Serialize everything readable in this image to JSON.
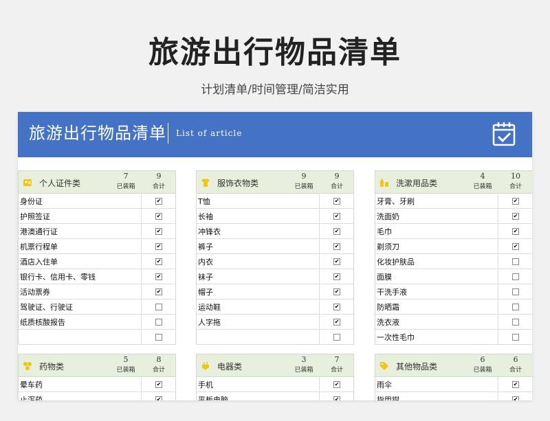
{
  "header": {
    "title": "旅游出行物品清单",
    "subtitle": "计划清单/时间管理/简洁实用"
  },
  "banner": {
    "title": "旅游出行物品清单",
    "subtitle": "List of article"
  },
  "labels": {
    "packed": "已装箱",
    "total": "合计"
  },
  "colors": {
    "banner": "#4472c4",
    "category_header": "#e6f0dc",
    "icon": "#f0c419"
  },
  "categories": [
    {
      "name": "个人证件类",
      "icon": "id-card-icon",
      "packed": "7",
      "total": "9",
      "items": [
        {
          "label": "身份证",
          "checked": true
        },
        {
          "label": "护照签证",
          "checked": true
        },
        {
          "label": "港澳通行证",
          "checked": true
        },
        {
          "label": "机票行程单",
          "checked": true
        },
        {
          "label": "酒店入住单",
          "checked": true
        },
        {
          "label": "银行卡、信用卡、零钱",
          "checked": true
        },
        {
          "label": "活动票券",
          "checked": true
        },
        {
          "label": "驾驶证、行驶证",
          "checked": false
        },
        {
          "label": "纸质核酸报告",
          "checked": false
        },
        {
          "label": "",
          "checked": false
        }
      ]
    },
    {
      "name": "服饰衣物类",
      "icon": "tshirt-icon",
      "packed": "9",
      "total": "9",
      "items": [
        {
          "label": "T恤",
          "checked": true
        },
        {
          "label": "长袖",
          "checked": true
        },
        {
          "label": "冲锋衣",
          "checked": true
        },
        {
          "label": "裤子",
          "checked": true
        },
        {
          "label": "内衣",
          "checked": true
        },
        {
          "label": "袜子",
          "checked": true
        },
        {
          "label": "帽子",
          "checked": true
        },
        {
          "label": "运动鞋",
          "checked": true
        },
        {
          "label": "人字拖",
          "checked": true
        },
        {
          "label": "",
          "checked": false
        }
      ]
    },
    {
      "name": "洗漱用品类",
      "icon": "toiletries-icon",
      "packed": "4",
      "total": "10",
      "items": [
        {
          "label": "牙膏、牙刷",
          "checked": true
        },
        {
          "label": "洗面奶",
          "checked": true
        },
        {
          "label": "毛巾",
          "checked": true
        },
        {
          "label": "剃须刀",
          "checked": true
        },
        {
          "label": "化妆护肤品",
          "checked": false
        },
        {
          "label": "面膜",
          "checked": false
        },
        {
          "label": "干洗手液",
          "checked": false
        },
        {
          "label": "防晒霜",
          "checked": false
        },
        {
          "label": "洗衣液",
          "checked": false
        },
        {
          "label": "一次性毛巾",
          "checked": false
        }
      ]
    },
    {
      "name": "药物类",
      "icon": "medicine-icon",
      "packed": "5",
      "total": "8",
      "items": [
        {
          "label": "晕车药",
          "checked": true
        },
        {
          "label": "止泻药",
          "checked": true
        }
      ]
    },
    {
      "name": "电器类",
      "icon": "plug-icon",
      "packed": "3",
      "total": "7",
      "items": [
        {
          "label": "手机",
          "checked": true
        },
        {
          "label": "平板电脑",
          "checked": true
        }
      ]
    },
    {
      "name": "其他物品类",
      "icon": "tag-icon",
      "packed": "6",
      "total": "6",
      "items": [
        {
          "label": "雨伞",
          "checked": true
        },
        {
          "label": "指甲钳",
          "checked": true
        }
      ]
    }
  ]
}
